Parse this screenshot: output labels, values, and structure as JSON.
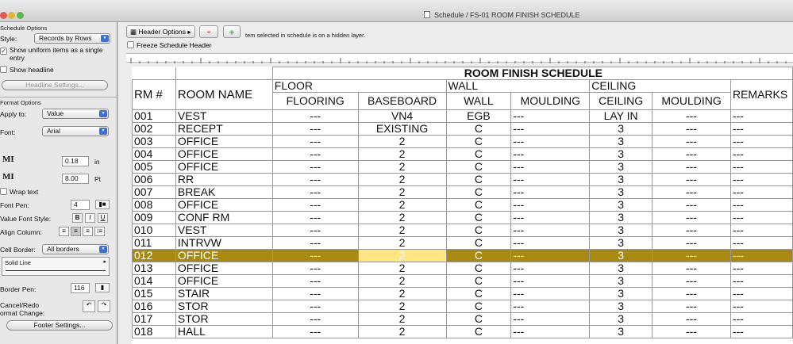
{
  "window": {
    "title": "Schedule / FS-01 ROOM FINISH SCHEDULE"
  },
  "palette": {
    "schedule_options": "Schedule Options",
    "style_label": "Style:",
    "style_value": "Records by Rows",
    "uniform_label1": "Show uniform items as a single",
    "uniform_label2": "entry",
    "headline_label": "Show headline",
    "headline_settings": "Headline Settings...",
    "format_options": "Format Options",
    "apply_label": "Apply to:",
    "apply_value": "Value",
    "font_label": "Font:",
    "font_value": "Arial",
    "margin_icon1": "MI",
    "margin_val1": "0.18",
    "margin_unit1": "in",
    "margin_icon2": "MI",
    "margin_val2": "8.00",
    "margin_unit2": "Pt",
    "wrap_label": "Wrap text",
    "font_pen_label": "Font Pen:",
    "font_pen_value": "4",
    "value_font_style": "Value Font Style:",
    "bold": "B",
    "italic": "I",
    "underline": "U",
    "align_label": "Align Column:",
    "cell_border_label": "Cell Border:",
    "cell_border_value": "All borders",
    "line_style": "Solid Line",
    "border_pen_label": "Border Pen:",
    "border_pen_value": "116",
    "cancel_redo1": "Cancel/Redo",
    "cancel_redo2": "ormat Change:",
    "footer_settings": "Footer Settings..."
  },
  "toolbar": {
    "header_options": "Header Options",
    "hint": "tem selected in schedule is on a hidden layer.",
    "freeze": "Freeze Schedule Header"
  },
  "schedule": {
    "title": "ROOM FINISH SCHEDULE",
    "h_rm": "RM #",
    "h_room": "ROOM NAME",
    "h_floor": "FLOOR",
    "h_wall": "WALL",
    "h_ceiling": "CEILING",
    "h_remarks": "REMARKS",
    "h_flooring": "FLOORING",
    "h_baseboard": "BASEBOARD",
    "h_wall2": "WALL",
    "h_moulding": "MOULDING",
    "h_ceiling2": "CEILING",
    "h_moulding2": "MOULDING",
    "rows": [
      [
        "001",
        "VEST",
        "---",
        "VN4",
        "EGB",
        "---",
        "LAY IN",
        "---",
        "---"
      ],
      [
        "002",
        "RECEPT",
        "---",
        "EXISTING",
        "C",
        "---",
        "3",
        "---",
        "---"
      ],
      [
        "003",
        "OFFICE",
        "---",
        "2",
        "C",
        "---",
        "3",
        "---",
        "---"
      ],
      [
        "004",
        "OFFICE",
        "---",
        "2",
        "C",
        "---",
        "3",
        "---",
        "---"
      ],
      [
        "005",
        "OFFICE",
        "---",
        "2",
        "C",
        "---",
        "3",
        "---",
        "---"
      ],
      [
        "006",
        "RR",
        "---",
        "2",
        "C",
        "---",
        "3",
        "---",
        "---"
      ],
      [
        "007",
        "BREAK",
        "---",
        "2",
        "C",
        "---",
        "3",
        "---",
        "---"
      ],
      [
        "008",
        "OFFICE",
        "---",
        "2",
        "C",
        "---",
        "3",
        "---",
        "---"
      ],
      [
        "009",
        "CONF RM",
        "---",
        "2",
        "C",
        "---",
        "3",
        "---",
        "---"
      ],
      [
        "010",
        "VEST",
        "---",
        "2",
        "C",
        "---",
        "3",
        "---",
        "---"
      ],
      [
        "011",
        "INTRVW",
        "---",
        "2",
        "C",
        "---",
        "3",
        "---",
        "---"
      ],
      [
        "012",
        "OFFICE",
        "---",
        "2",
        "C",
        "---",
        "3",
        "---",
        "---"
      ],
      [
        "013",
        "OFFICE",
        "---",
        "2",
        "C",
        "---",
        "3",
        "---",
        "---"
      ],
      [
        "014",
        "OFFICE",
        "---",
        "2",
        "C",
        "---",
        "3",
        "---",
        "---"
      ],
      [
        "015",
        "STAIR",
        "---",
        "2",
        "C",
        "---",
        "3",
        "---",
        "---"
      ],
      [
        "016",
        "STOR",
        "---",
        "2",
        "C",
        "---",
        "3",
        "---",
        "---"
      ],
      [
        "017",
        "STOR",
        "---",
        "2",
        "C",
        "---",
        "3",
        "---",
        "---"
      ],
      [
        "018",
        "HALL",
        "---",
        "2",
        "C",
        "---",
        "3",
        "---",
        "---"
      ]
    ]
  },
  "colors": {
    "highlight": "#a88a10",
    "current_cell": "#ffe680"
  }
}
